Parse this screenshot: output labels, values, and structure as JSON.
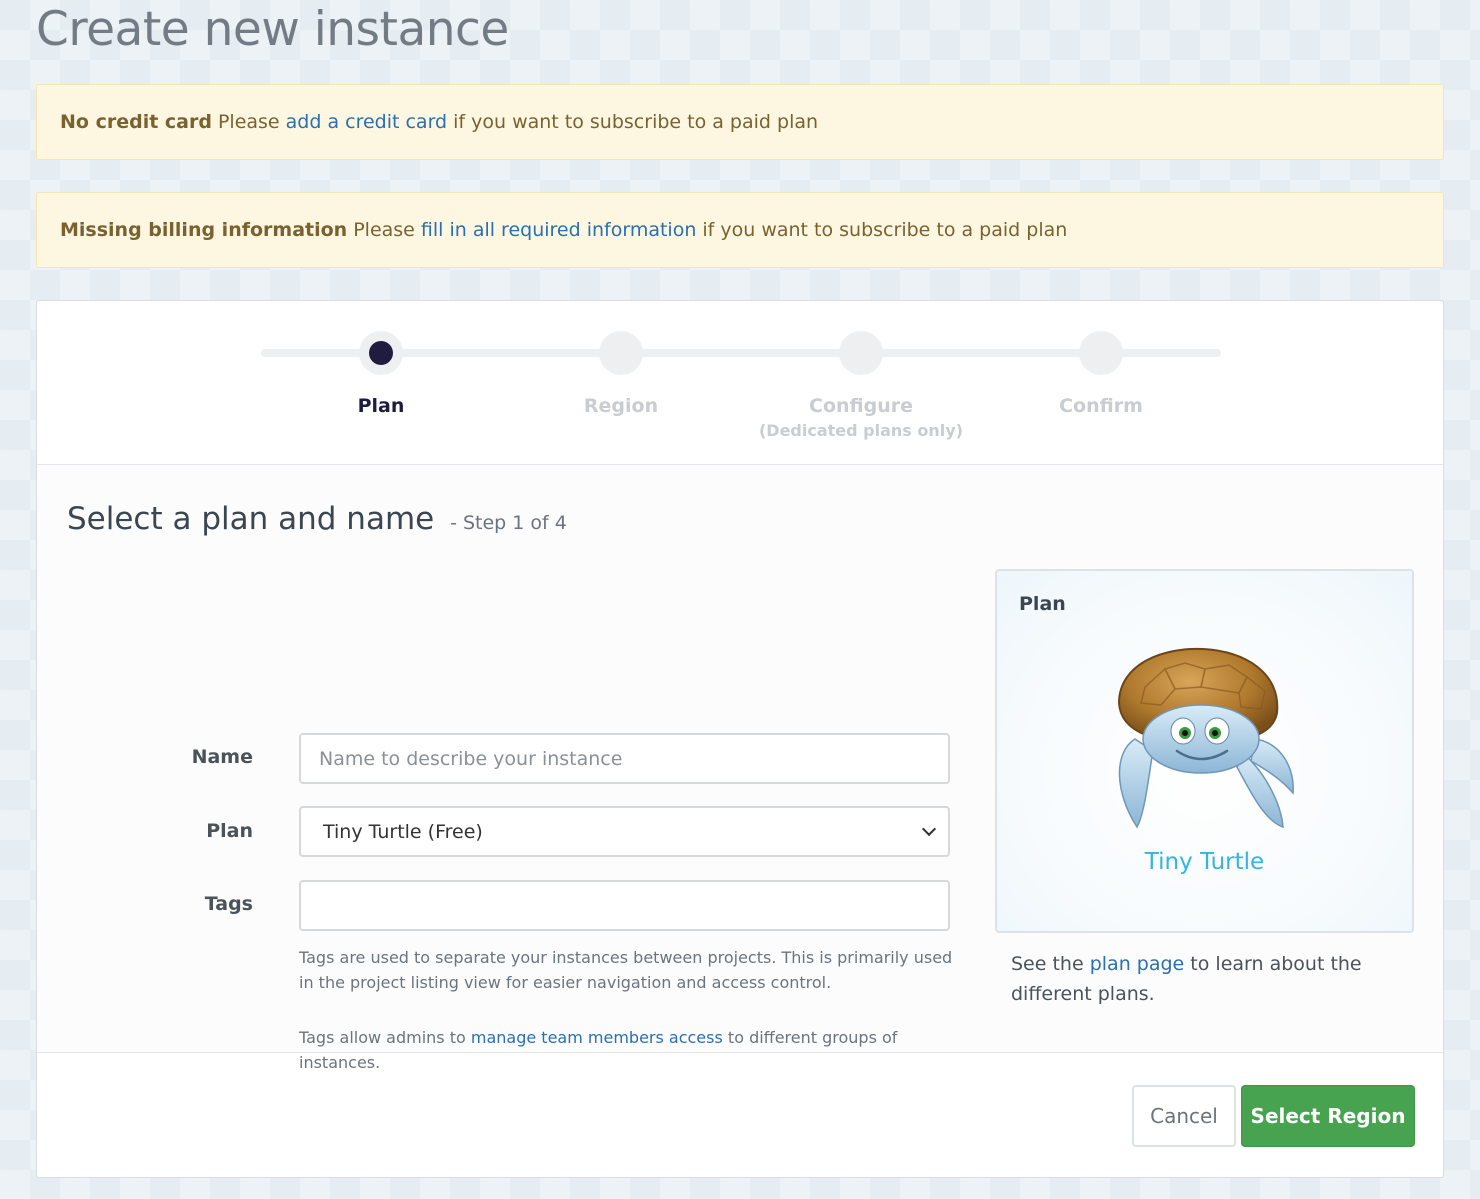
{
  "page": {
    "title": "Create new instance"
  },
  "alerts": [
    {
      "strong": "No credit card",
      "before": "Please",
      "link": "add a credit card",
      "after": "if you want to subscribe to a paid plan"
    },
    {
      "strong": "Missing billing information",
      "before": "Please",
      "link": "fill in all required information",
      "after": "if you want to subscribe to a paid plan"
    }
  ],
  "steps": [
    {
      "label": "Plan",
      "sub": "",
      "active": true
    },
    {
      "label": "Region",
      "sub": ""
    },
    {
      "label": "Configure",
      "sub": "(Dedicated plans only)"
    },
    {
      "label": "Confirm",
      "sub": ""
    }
  ],
  "section": {
    "title": "Select a plan and name",
    "step_of": "- Step 1 of 4"
  },
  "form": {
    "name_label": "Name",
    "name_placeholder": "Name to describe your instance",
    "name_value": "",
    "plan_label": "Plan",
    "plan_selected": "Tiny Turtle (Free)",
    "tags_label": "Tags",
    "tags_value": "",
    "help_1": "Tags are used to separate your instances between projects. This is primarily used in the project listing view for easier navigation and access control.",
    "help_2_before": "Tags allow admins to",
    "help_2_link": "manage team members access",
    "help_2_after": "to different groups of instances."
  },
  "plan_card": {
    "heading": "Plan",
    "name": "Tiny Turtle",
    "icon": "turtle-illustration",
    "note_before": "See the",
    "note_link": "plan page",
    "note_after": "to learn about the different plans."
  },
  "footer": {
    "cancel_label": "Cancel",
    "next_label": "Select Region"
  },
  "colors": {
    "primary": "#47a34f",
    "link": "#2a6fb0",
    "accent": "#34b4e3",
    "alert_bg": "#fdf7e1",
    "active_step": "#1f1d3f"
  }
}
